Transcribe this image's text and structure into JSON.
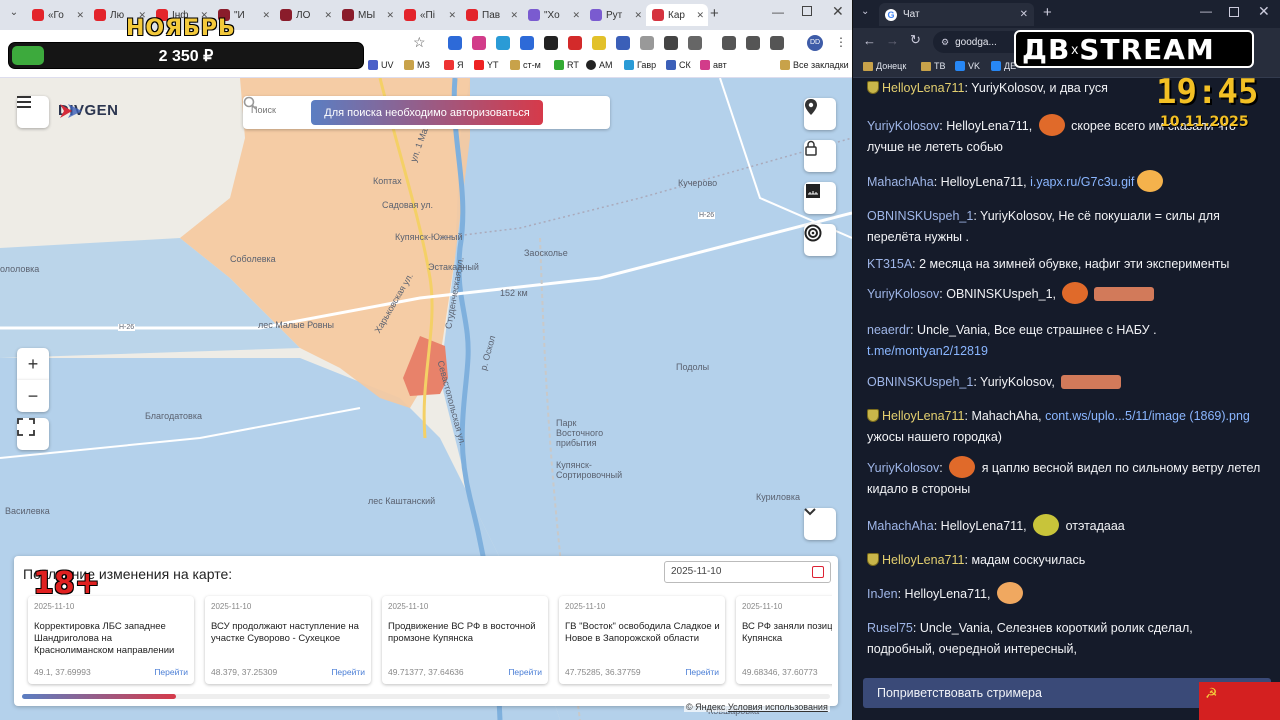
{
  "overlay": {
    "month": "НОЯБРЬ",
    "money": "2 350 ₽",
    "money_progress": 0.09,
    "age": "18+",
    "stream_brand_left": "ДВ",
    "stream_brand_x": "x",
    "stream_brand_right": "STREAM",
    "clock": "19:45",
    "date": "10.11.2025"
  },
  "left_browser": {
    "tabs": [
      {
        "label": "«Го",
        "color": "#e3242b"
      },
      {
        "label": "Лю",
        "color": "#e3242b"
      },
      {
        "label": "Інф",
        "color": "#e3242b"
      },
      {
        "label": "\"И",
        "color": "#8a1c2b"
      },
      {
        "label": "ЛО",
        "color": "#8a1c2b"
      },
      {
        "label": "МЫ",
        "color": "#8a1c2b"
      },
      {
        "label": "«Пі",
        "color": "#e3242b"
      },
      {
        "label": "Пав",
        "color": "#e3242b"
      },
      {
        "label": "\"Хо",
        "color": "#7a5bd0"
      },
      {
        "label": "Рут",
        "color": "#7a5bd0"
      },
      {
        "label": "Кар",
        "color": "#d5333f"
      }
    ],
    "bookmarks": [
      "UV",
      "МЗ",
      "Я",
      "YT",
      "ст-м",
      "RT",
      "AM",
      "Гавр",
      "СК",
      "авт",
      "Все закладки"
    ]
  },
  "map": {
    "logo": "DIVGEN",
    "search_placeholder": "Поиск",
    "auth_button": "Для поиска необходимо авторизоваться",
    "zoom_in": "+",
    "zoom_out": "−",
    "labels": [
      "Кучерово",
      "Купянск-Южный",
      "Эстакадный",
      "Заоскольe",
      "Соболевка",
      "лес Малые Ровны",
      "Благодатовка",
      "Подолы",
      "Парк Восточного прибытия",
      "Купянск-Сортировочный",
      "Куриловка",
      "лес Каштанский",
      "Василевка",
      "ололовка",
      "Коптах",
      "152 км",
      "Ковшаровка",
      "Н-26",
      "Н-26",
      "ул. 1 Мая",
      "Садовая ул.",
      "Харьковская ул.",
      "Студенческая ул.",
      "Севастопольская ул.",
      "р. Оскол"
    ],
    "changes_title": "Последние изменения на карте:",
    "date_value": "2025-11-10",
    "cards": [
      {
        "date": "2025-11-10",
        "text": "Корректировка ЛБС западнее Шандриголова на Краснолиманском направлении",
        "coords": "49.1, 37.69993",
        "link": "Перейти"
      },
      {
        "date": "2025-11-10",
        "text": "ВСУ продолжают наступление на участке Суворово - Сухецкое",
        "coords": "48.379, 37.25309",
        "link": "Перейти"
      },
      {
        "date": "2025-11-10",
        "text": "Продвижение ВС РФ в восточной промзоне Купянска",
        "coords": "49.71377, 37.64636",
        "link": "Перейти"
      },
      {
        "date": "2025-11-10",
        "text": "ГВ \"Восток\" освободила Сладкое и Новое в Запорожской области",
        "coords": "47.75285, 36.37759",
        "link": "Перейти"
      },
      {
        "date": "2025-11-10",
        "text": "ВС РФ заняли позиции в части Купянска",
        "coords": "49.68346, 37.60773",
        "link": "Перейти"
      }
    ],
    "scroll_progress": 0.19,
    "attribution_prefix": "© Яндекс",
    "attribution_link": "Условия использования"
  },
  "right_browser": {
    "tab_label": "Чат",
    "url": "goodga...",
    "bookmarks": [
      "Донецк",
      "ТВ",
      "VK",
      "ДЕ"
    ],
    "greet_button": "Поприветствовать стримера"
  },
  "chat": [
    {
      "nick": "HelloyLena711",
      "mod": true,
      "parts": [
        {
          "t": "YuriyKolosov, и два гуся"
        }
      ]
    },
    {
      "nick": "YuriyKolosov",
      "mod": false,
      "parts": [
        {
          "t": "HelloyLena711, "
        },
        {
          "emote": "#e06a2a"
        },
        {
          "t": " скорее всего им сказали что лучше не лететь собью"
        }
      ]
    },
    {
      "nick": "MahachAha",
      "mod": false,
      "parts": [
        {
          "t": "HelloyLena711, "
        },
        {
          "link": "i.yapx.ru/G7c3u.gif"
        },
        {
          "emote": "#f4b24c"
        }
      ]
    },
    {
      "nick": "OBNINSKUspeh_1",
      "mod": false,
      "parts": [
        {
          "t": "YuriyKolosov, Не сё покушали = силы для перелёта нужны ."
        }
      ]
    },
    {
      "nick": "KT315A",
      "mod": false,
      "parts": [
        {
          "t": "2 месяца на зимней обувке, нафиг эти эксперименты"
        }
      ]
    },
    {
      "nick": "YuriyKolosov",
      "mod": false,
      "parts": [
        {
          "t": "OBNINSKUspeh_1, "
        },
        {
          "emote": "#e06a2a"
        },
        {
          "emote_wide": "#d27a5a"
        }
      ]
    },
    {
      "nick": "neaerdr",
      "mod": false,
      "parts": [
        {
          "t": "Uncle_Vania, Все еще страшнее с НАБУ . "
        },
        {
          "link": "t.me/montyan2/12819"
        }
      ]
    },
    {
      "nick": "OBNINSKUspeh_1",
      "mod": false,
      "parts": [
        {
          "t": "YuriyKolosov, "
        },
        {
          "emote_wide": "#d27a5a"
        }
      ]
    },
    {
      "nick": "HelloyLena711",
      "mod": true,
      "parts": [
        {
          "t": "MahachAha, "
        },
        {
          "link": "cont.ws/uplo...5/11/image (1869).png"
        },
        {
          "t": " ужосы нашего городка)"
        }
      ]
    },
    {
      "nick": "YuriyKolosov",
      "mod": false,
      "parts": [
        {
          "emote": "#e06a2a"
        },
        {
          "t": " я цаплю весной видел по сильному ветру летел кидало в стороны"
        }
      ]
    },
    {
      "nick": "MahachAha",
      "mod": false,
      "parts": [
        {
          "t": "HelloyLena711, "
        },
        {
          "emote": "#c8c43a"
        },
        {
          "t": " отэтадааа"
        }
      ]
    },
    {
      "nick": "HelloyLena711",
      "mod": true,
      "parts": [
        {
          "t": "мадам соскучилась"
        }
      ]
    },
    {
      "nick": "InJen",
      "mod": false,
      "parts": [
        {
          "t": "HelloyLena711, "
        },
        {
          "emote": "#f0a860"
        }
      ]
    },
    {
      "nick": "Rusel75",
      "mod": false,
      "parts": [
        {
          "t": "Uncle_Vania, Селезнев короткий ролик сделал, подробный, очередной интересный,"
        }
      ]
    }
  ]
}
